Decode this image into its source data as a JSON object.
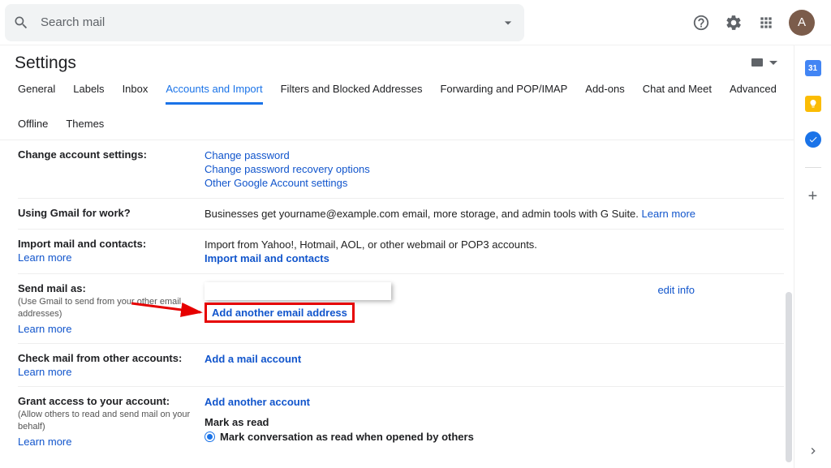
{
  "search": {
    "placeholder": "Search mail"
  },
  "avatar": {
    "initial": "A"
  },
  "title": "Settings",
  "tabs": [
    {
      "label": "General",
      "active": false
    },
    {
      "label": "Labels",
      "active": false
    },
    {
      "label": "Inbox",
      "active": false
    },
    {
      "label": "Accounts and Import",
      "active": true
    },
    {
      "label": "Filters and Blocked Addresses",
      "active": false
    },
    {
      "label": "Forwarding and POP/IMAP",
      "active": false
    },
    {
      "label": "Add-ons",
      "active": false
    },
    {
      "label": "Chat and Meet",
      "active": false
    },
    {
      "label": "Advanced",
      "active": false
    },
    {
      "label": "Offline",
      "active": false
    },
    {
      "label": "Themes",
      "active": false
    }
  ],
  "sections": {
    "change_account": {
      "label": "Change account settings:",
      "links": [
        "Change password",
        "Change password recovery options",
        "Other Google Account settings"
      ]
    },
    "gmail_work": {
      "label": "Using Gmail for work?",
      "text": "Businesses get yourname@example.com email, more storage, and admin tools with G Suite.",
      "learn_more": "Learn more"
    },
    "import_mail": {
      "label": "Import mail and contacts:",
      "learn_more": "Learn more",
      "text": "Import from Yahoo!, Hotmail, AOL, or other webmail or POP3 accounts.",
      "action": "Import mail and contacts"
    },
    "send_mail_as": {
      "label": "Send mail as:",
      "sub": "(Use Gmail to send from your other email addresses)",
      "learn_more": "Learn more",
      "action": "Add another email address",
      "edit_info": "edit info"
    },
    "check_mail": {
      "label": "Check mail from other accounts:",
      "learn_more": "Learn more",
      "action": "Add a mail account"
    },
    "grant_access": {
      "label": "Grant access to your account:",
      "sub": "(Allow others to read and send mail on your behalf)",
      "learn_more": "Learn more",
      "action": "Add another account",
      "mark_label": "Mark as read",
      "radio_label": "Mark conversation as read when opened by others"
    }
  }
}
